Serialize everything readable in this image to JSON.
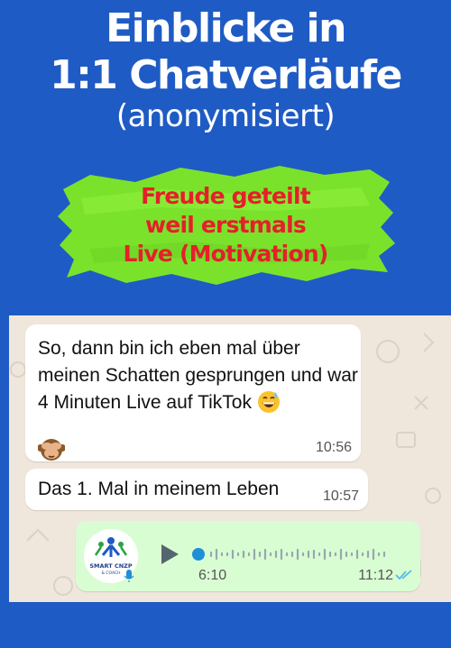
{
  "headline": {
    "line1": "Einblicke in",
    "line2": "1:1 Chatverläufe",
    "line3": "(anonymisiert)"
  },
  "banner": {
    "line1": "Freude geteilt",
    "line2": "weil erstmals",
    "line3": "Live (Motivation)",
    "highlight_color": "#7be22c",
    "text_color": "#e4202a"
  },
  "chat": {
    "messages": [
      {
        "text": "So, dann bin ich eben mal über meinen Schatten gesprungen und war 4 Minuten Live auf TikTok",
        "emojis": [
          "grinning-sweat-emoji",
          "see-no-evil-monkey-emoji"
        ],
        "time": "10:56"
      },
      {
        "text": "Das 1. Mal in meinem Leben",
        "time": "10:57"
      }
    ],
    "voice_message": {
      "avatar_text": "SMART CNZP",
      "avatar_subtext": "& COACH",
      "duration": "6:10",
      "time": "11:12",
      "read_ticks_color": "#53bdeb",
      "bubble_color": "#d9fdd3",
      "progress_fraction": 0.0
    }
  },
  "colors": {
    "background": "#1f5bc4",
    "chat_background": "#efe7dc"
  }
}
